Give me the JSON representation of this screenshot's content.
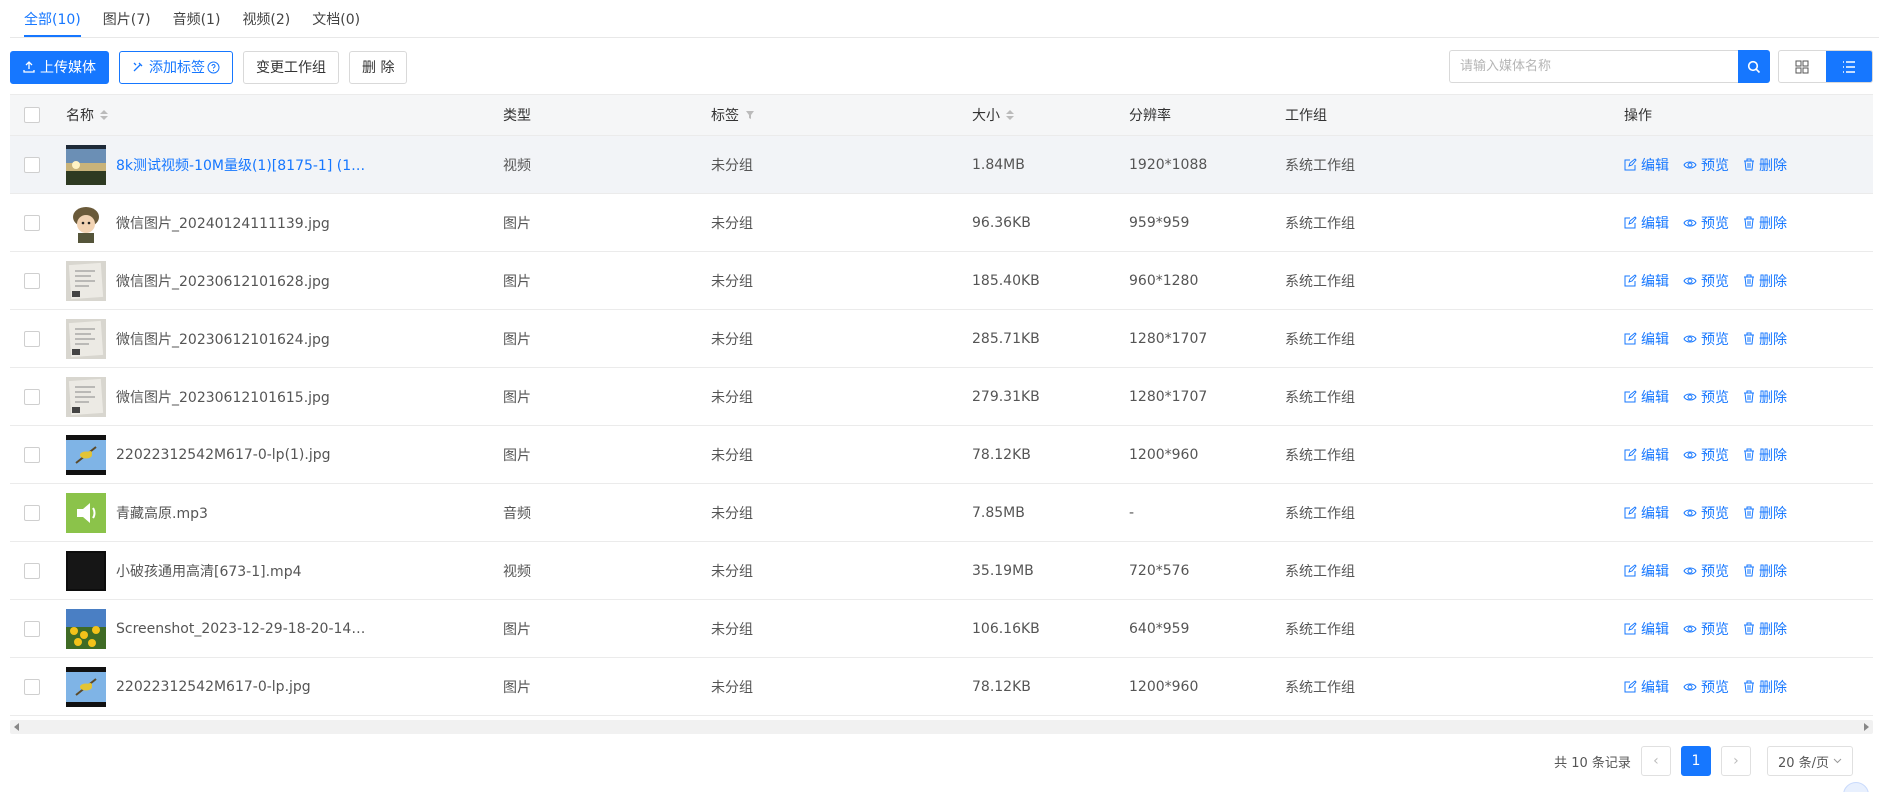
{
  "tabs": [
    {
      "label": "全部(10)",
      "active": true
    },
    {
      "label": "图片(7)",
      "active": false
    },
    {
      "label": "音频(1)",
      "active": false
    },
    {
      "label": "视频(2)",
      "active": false
    },
    {
      "label": "文档(0)",
      "active": false
    }
  ],
  "toolbar": {
    "upload_label": "上传媒体",
    "add_tag_label": "添加标签",
    "change_group_label": "变更工作组",
    "delete_label": "删 除"
  },
  "search": {
    "placeholder": "请输入媒体名称",
    "value": ""
  },
  "colors": {
    "accent": "#1677ff"
  },
  "table": {
    "headers": {
      "name": "名称",
      "type": "类型",
      "tag": "标签",
      "size": "大小",
      "resolution": "分辨率",
      "group": "工作组",
      "actions": "操作"
    },
    "actions": {
      "edit": "编辑",
      "preview": "预览",
      "delete": "删除"
    },
    "rows": [
      {
        "name": "8k测试视频-10M量级(1)[8175-1] (1)....",
        "type": "视频",
        "tag": "未分组",
        "size": "1.84MB",
        "resolution": "1920*1088",
        "group": "系统工作组",
        "thumb": "landscape-video"
      },
      {
        "name": "微信图片_20240124111139.jpg",
        "type": "图片",
        "tag": "未分组",
        "size": "96.36KB",
        "resolution": "959*959",
        "group": "系统工作组",
        "thumb": "cartoon-soldier"
      },
      {
        "name": "微信图片_20230612101628.jpg",
        "type": "图片",
        "tag": "未分组",
        "size": "185.40KB",
        "resolution": "960*1280",
        "group": "系统工作组",
        "thumb": "paper-document"
      },
      {
        "name": "微信图片_20230612101624.jpg",
        "type": "图片",
        "tag": "未分组",
        "size": "285.71KB",
        "resolution": "1280*1707",
        "group": "系统工作组",
        "thumb": "paper-document"
      },
      {
        "name": "微信图片_20230612101615.jpg",
        "type": "图片",
        "tag": "未分组",
        "size": "279.31KB",
        "resolution": "1280*1707",
        "group": "系统工作组",
        "thumb": "paper-document"
      },
      {
        "name": "22022312542M617-0-lp(1).jpg",
        "type": "图片",
        "tag": "未分组",
        "size": "78.12KB",
        "resolution": "1200*960",
        "group": "系统工作组",
        "thumb": "bird-sky"
      },
      {
        "name": "青藏高原.mp3",
        "type": "音频",
        "tag": "未分组",
        "size": "7.85MB",
        "resolution": "-",
        "group": "系统工作组",
        "thumb": "audio-speaker"
      },
      {
        "name": "小破孩通用高清[673-1].mp4",
        "type": "视频",
        "tag": "未分组",
        "size": "35.19MB",
        "resolution": "720*576",
        "group": "系统工作组",
        "thumb": "dark-video"
      },
      {
        "name": "Screenshot_2023-12-29-18-20-14-78...",
        "type": "图片",
        "tag": "未分组",
        "size": "106.16KB",
        "resolution": "640*959",
        "group": "系统工作组",
        "thumb": "sunflowers"
      },
      {
        "name": "22022312542M617-0-lp.jpg",
        "type": "图片",
        "tag": "未分组",
        "size": "78.12KB",
        "resolution": "1200*960",
        "group": "系统工作组",
        "thumb": "bird-sky"
      }
    ]
  },
  "pagination": {
    "total_label": "共 10 条记录",
    "current_page": "1",
    "page_size_label": "20 条/页"
  }
}
